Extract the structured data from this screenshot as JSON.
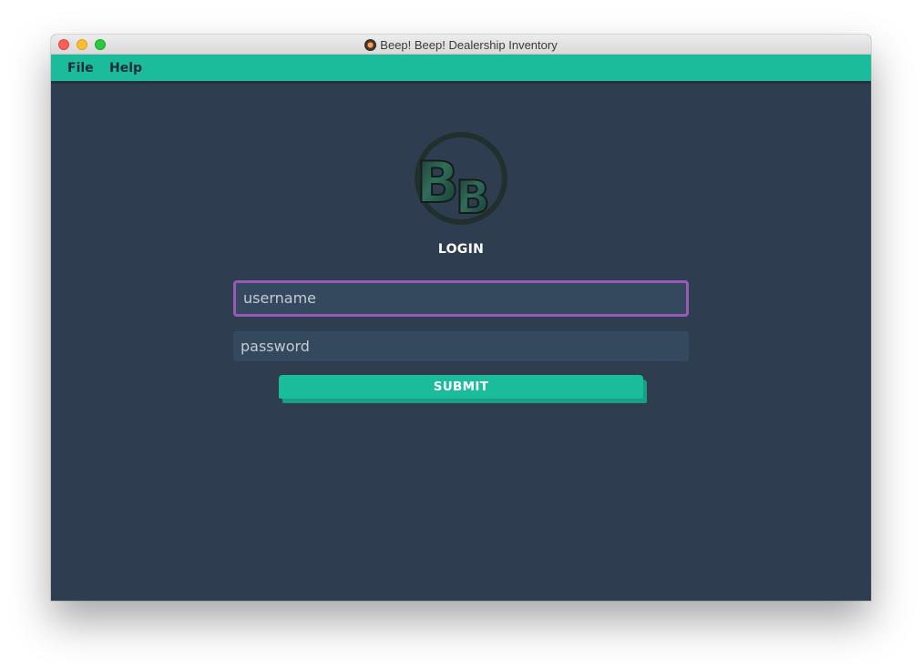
{
  "window": {
    "title": "Beep! Beep! Dealership Inventory",
    "app_icon": "app-icon"
  },
  "menu": {
    "items": [
      {
        "label": "File"
      },
      {
        "label": "Help"
      }
    ]
  },
  "login": {
    "logo_text": "BB",
    "heading": "LOGIN",
    "username_placeholder": "username",
    "password_placeholder": "password",
    "submit_label": "SUBMIT"
  },
  "colors": {
    "background": "#2e3e50",
    "accent": "#1abc9c",
    "accent_shadow": "#16a085",
    "field_bg": "#34495e",
    "focus_border": "#9b59b6"
  }
}
